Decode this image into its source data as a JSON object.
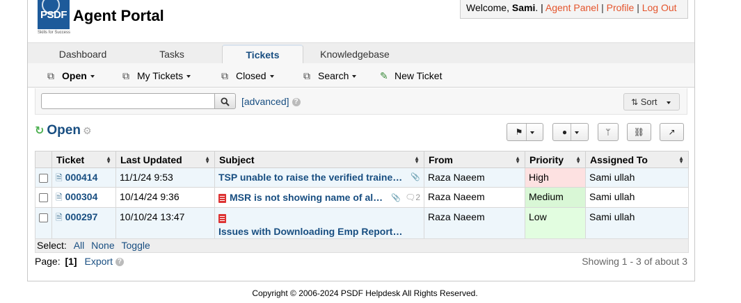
{
  "header": {
    "logo_text": "PSDF",
    "logo_tagline": "Skills for Success",
    "title": "Agent Portal",
    "welcome_prefix": "Welcome, ",
    "username": "Sami",
    "welcome_suffix": ". |",
    "links": [
      "Agent Panel",
      "Profile",
      "Log Out"
    ]
  },
  "tabs": [
    {
      "label": "Dashboard",
      "active": false
    },
    {
      "label": "Tasks",
      "active": false
    },
    {
      "label": "Tickets",
      "active": true
    },
    {
      "label": "Knowledgebase",
      "active": false
    }
  ],
  "subnav": [
    {
      "label": "Open",
      "icon": "copy-icon",
      "bold": true,
      "dropdown": true
    },
    {
      "label": "My Tickets",
      "icon": "copy-icon",
      "dropdown": true
    },
    {
      "label": "Closed",
      "icon": "copy-icon",
      "dropdown": true
    },
    {
      "label": "Search",
      "icon": "copy-icon",
      "dropdown": true
    },
    {
      "label": "New Ticket",
      "icon": "new-ticket-icon",
      "dropdown": false
    }
  ],
  "search": {
    "value": "",
    "placeholder": "",
    "advanced_label": "[advanced]",
    "sort_label": "Sort"
  },
  "queue": {
    "title": "Open",
    "action_buttons": [
      "flag",
      "assign",
      "merge",
      "link",
      "share"
    ]
  },
  "table": {
    "columns": [
      "Ticket",
      "Last Updated",
      "Subject",
      "From",
      "Priority",
      "Assigned To"
    ],
    "rows": [
      {
        "ticket": "000414",
        "updated": "11/1/24 9:53",
        "subject": "TSP unable to raise the verified traine…",
        "attachment": true,
        "pdf": false,
        "thread_count": "",
        "from": "Raza Naeem",
        "priority": "High",
        "assigned": "Sami ullah"
      },
      {
        "ticket": "000304",
        "updated": "10/14/24 9:36",
        "subject": "MSR is not showing name of al…",
        "attachment": true,
        "pdf": true,
        "thread_count": "2",
        "from": "Raza Naeem",
        "priority": "Medium",
        "assigned": "Sami ullah"
      },
      {
        "ticket": "000297",
        "updated": "10/10/24 13:47",
        "subject": "Issues with Downloading Emp Report…",
        "attachment": false,
        "pdf": true,
        "thread_count": "",
        "from": "Raza Naeem",
        "priority": "Low",
        "assigned": "Sami ullah"
      }
    ]
  },
  "select_bar": {
    "label": "Select:",
    "options": [
      "All",
      "None",
      "Toggle"
    ]
  },
  "pager": {
    "label": "Page:",
    "current": "[1]",
    "export_label": "Export",
    "showing": "Showing 1 - 3 of about 3"
  },
  "footer": {
    "copyright": "Copyright © 2006-2024 PSDF Helpdesk All Rights Reserved."
  },
  "colors": {
    "link": "#184e81",
    "header_link": "#e4542c",
    "priority_high": "#fde1e1",
    "priority_medium": "#d9f7d6",
    "priority_low": "#e2fde0"
  }
}
